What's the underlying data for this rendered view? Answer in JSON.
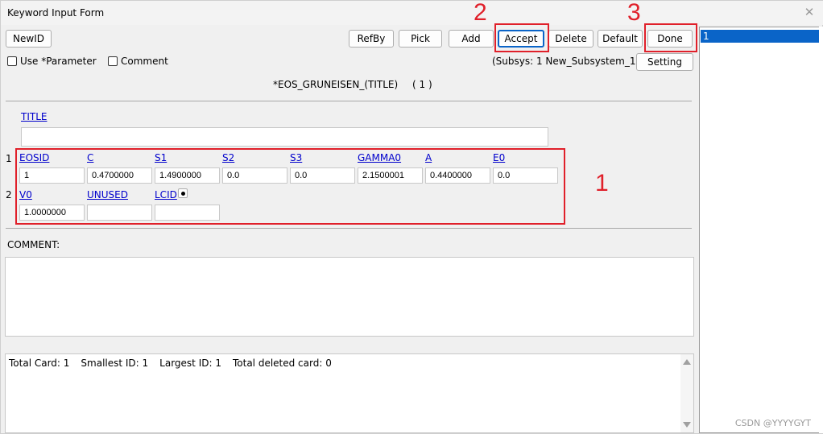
{
  "window": {
    "title": "Keyword Input Form"
  },
  "toolbar": {
    "newid": "NewID",
    "refby": "RefBy",
    "pick": "Pick",
    "add": "Add",
    "accept": "Accept",
    "delete": "Delete",
    "default": "Default",
    "done": "Done",
    "setting": "Setting"
  },
  "options": {
    "use_parameter": "Use *Parameter",
    "comment": "Comment",
    "subsys": "(Subsys: 1 New_Subsystem_1)"
  },
  "keyword": {
    "name": "*EOS_GRUNEISEN_(TITLE)",
    "count": "( 1 )",
    "title_label": "TITLE",
    "title_value": "",
    "rows": [
      {
        "number": "1",
        "fields": [
          {
            "label": "EOSID",
            "value": "1"
          },
          {
            "label": "C",
            "value": "0.4700000"
          },
          {
            "label": "S1",
            "value": "1.4900000"
          },
          {
            "label": "S2",
            "value": "0.0"
          },
          {
            "label": "S3",
            "value": "0.0"
          },
          {
            "label": "GAMMA0",
            "value": "2.1500001"
          },
          {
            "label": "A",
            "value": "0.4400000"
          },
          {
            "label": "E0",
            "value": "0.0"
          }
        ]
      },
      {
        "number": "2",
        "fields": [
          {
            "label": "V0",
            "value": "1.0000000"
          },
          {
            "label": "UNUSED",
            "value": ""
          },
          {
            "label": "LCID",
            "value": ""
          }
        ]
      }
    ]
  },
  "comment_section": {
    "label": "COMMENT:",
    "value": ""
  },
  "stats": {
    "total_card": "Total Card: 1",
    "smallest_id": "Smallest ID: 1",
    "largest_id": "Largest ID: 1",
    "total_deleted": "Total deleted card:  0"
  },
  "id_list": {
    "items": [
      "1"
    ]
  },
  "annotations": {
    "box1": "1",
    "box2": "2",
    "box3": "3"
  },
  "watermark": "CSDN @YYYYGYT",
  "colors": {
    "accent": "#0a64c8",
    "annotation": "#e0202a",
    "link": "#0000cc"
  }
}
